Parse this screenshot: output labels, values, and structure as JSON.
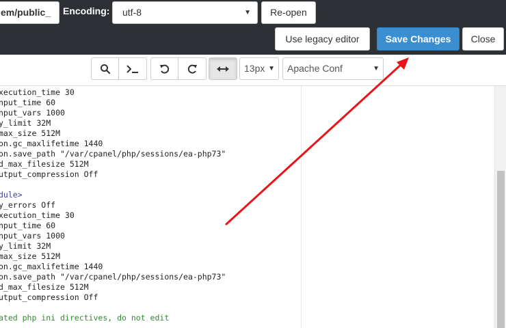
{
  "header": {
    "path_value": "em/public_",
    "encoding_label": "Encoding:",
    "encoding_value": "utf-8",
    "reopen_label": "Re-open",
    "legacy_label": "Use legacy editor",
    "save_label": "Save Changes",
    "close_label": "Close"
  },
  "toolbar": {
    "icons": [
      "search-icon",
      "terminal-icon",
      "undo-icon",
      "redo-icon",
      "wrap-toggle-icon"
    ],
    "font_size": "13px",
    "mode": "Apache Conf"
  },
  "editor": {
    "lines": [
      {
        "text": "xecution_time 30",
        "kind": "plain"
      },
      {
        "text": "nput_time 60",
        "kind": "plain"
      },
      {
        "text": "nput_vars 1000",
        "kind": "plain"
      },
      {
        "text": "y_limit 32M",
        "kind": "plain"
      },
      {
        "text": "max_size 512M",
        "kind": "plain"
      },
      {
        "text": "on.gc_maxlifetime 1440",
        "kind": "plain"
      },
      {
        "text": "on.save_path \"/var/cpanel/php/sessions/ea-php73\"",
        "kind": "plain"
      },
      {
        "text": "d_max_filesize 512M",
        "kind": "plain"
      },
      {
        "text": "utput_compression Off",
        "kind": "plain"
      },
      {
        "text": "",
        "kind": "plain"
      },
      {
        "text": "dule>",
        "kind": "tag"
      },
      {
        "text": "y_errors Off",
        "kind": "plain"
      },
      {
        "text": "xecution_time 30",
        "kind": "plain"
      },
      {
        "text": "nput_time 60",
        "kind": "plain"
      },
      {
        "text": "nput_vars 1000",
        "kind": "plain"
      },
      {
        "text": "y_limit 32M",
        "kind": "plain"
      },
      {
        "text": "max_size 512M",
        "kind": "plain"
      },
      {
        "text": "on.gc_maxlifetime 1440",
        "kind": "plain"
      },
      {
        "text": "on.save_path \"/var/cpanel/php/sessions/ea-php73\"",
        "kind": "plain"
      },
      {
        "text": "d_max_filesize 512M",
        "kind": "plain"
      },
      {
        "text": "utput_compression Off",
        "kind": "plain"
      },
      {
        "text": "",
        "kind": "plain"
      },
      {
        "text": "ated php ini directives, do not edit",
        "kind": "comment"
      }
    ]
  },
  "colors": {
    "topbar": "#2d3035",
    "save_button": "#3b8fd1",
    "annotation_arrow": "#e8141a"
  }
}
